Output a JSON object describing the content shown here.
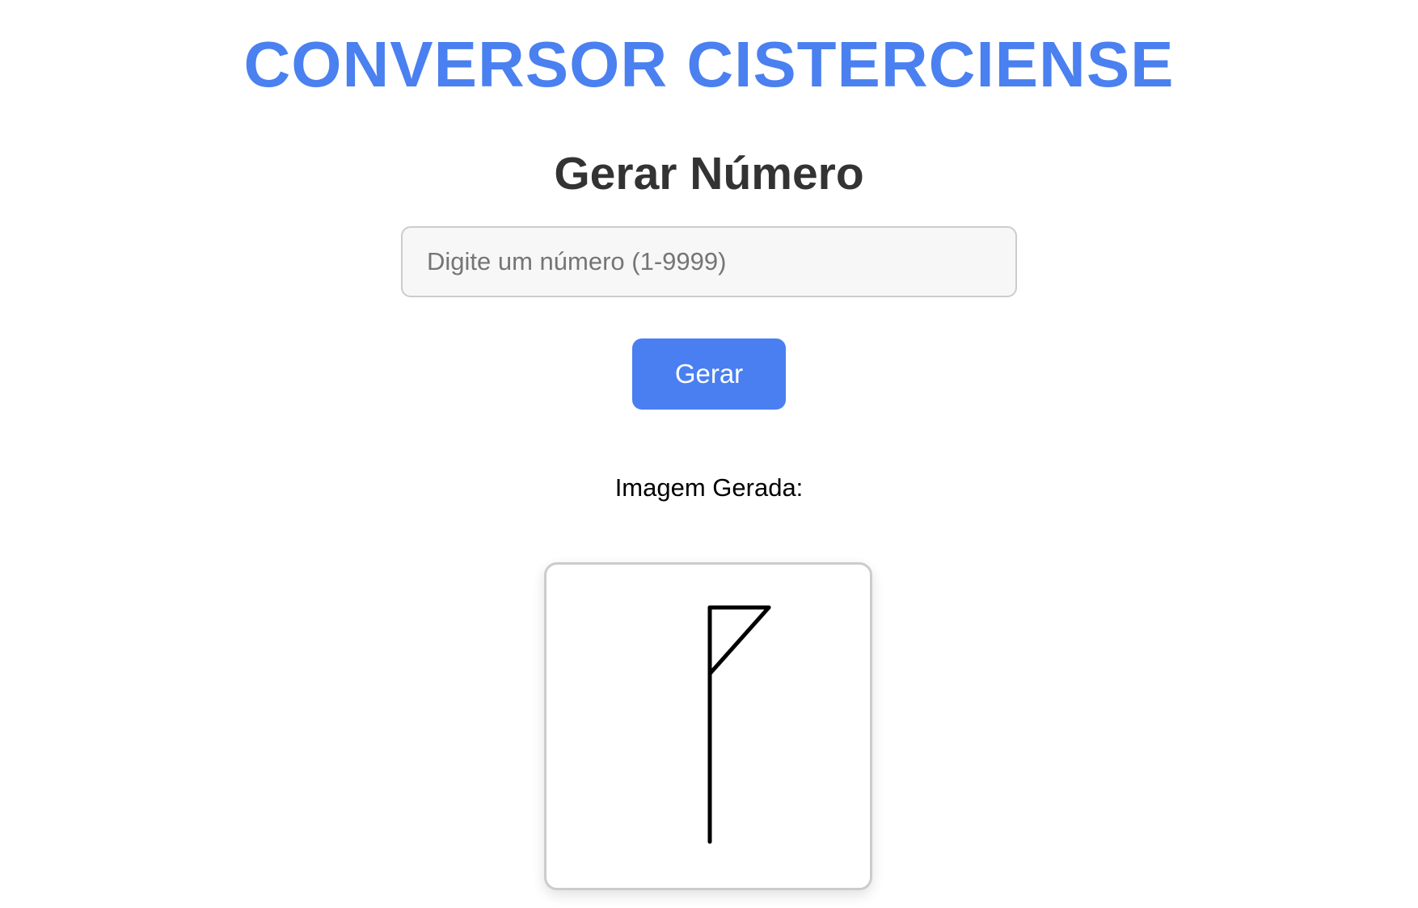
{
  "header": {
    "title": "CONVERSOR CISTERCIENSE",
    "accent_color": "#4a80f0"
  },
  "generator": {
    "section_title": "Gerar Número",
    "input_placeholder": "Digite um número (1-9999)",
    "input_value": "",
    "button_label": "Gerar",
    "button_color": "#4a7ff2"
  },
  "result": {
    "label": "Imagem Gerada:",
    "image_description": "cistercian-numeral-glyph"
  }
}
